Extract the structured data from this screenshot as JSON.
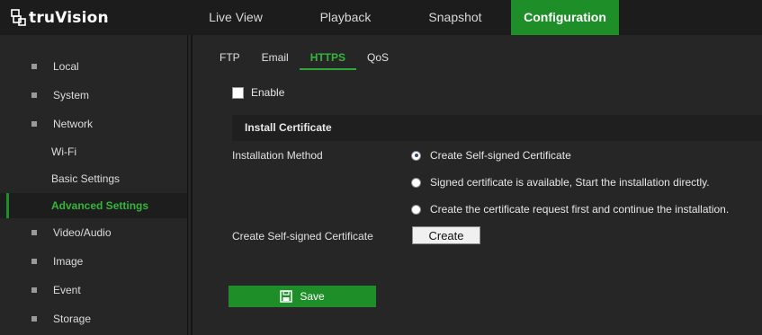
{
  "brand": {
    "name": "truVision"
  },
  "topnav": {
    "tabs": [
      {
        "label": "Live View"
      },
      {
        "label": "Playback"
      },
      {
        "label": "Snapshot"
      },
      {
        "label": "Configuration",
        "active": true
      }
    ]
  },
  "sidebar": {
    "items": [
      {
        "label": "Local"
      },
      {
        "label": "System"
      },
      {
        "label": "Network"
      },
      {
        "label": "Wi-Fi"
      },
      {
        "label": "Basic Settings"
      },
      {
        "label": "Advanced Settings",
        "active": true
      },
      {
        "label": "Video/Audio"
      },
      {
        "label": "Image"
      },
      {
        "label": "Event"
      },
      {
        "label": "Storage"
      }
    ]
  },
  "subtabs": [
    {
      "label": "FTP"
    },
    {
      "label": "Email"
    },
    {
      "label": "HTTPS",
      "active": true
    },
    {
      "label": "QoS"
    }
  ],
  "form": {
    "enable_label": "Enable",
    "enable_checked": false,
    "section_title": "Install Certificate",
    "installation_method_label": "Installation Method",
    "options": [
      {
        "label": "Create Self-signed Certificate",
        "checked": true
      },
      {
        "label": "Signed certificate is available, Start the installation directly.",
        "checked": false
      },
      {
        "label": "Create the certificate request first and continue the installation.",
        "checked": false
      }
    ],
    "create_cert_label": "Create Self-signed Certificate",
    "create_button": "Create",
    "save_button": "Save"
  },
  "colors": {
    "accent": "#1e8f28",
    "accent_text": "#36b53c",
    "background": "#262626",
    "topbar": "#1c1c1c"
  },
  "icons": {
    "logo": "truvision-logo-icon",
    "save": "floppy-disk-icon"
  }
}
